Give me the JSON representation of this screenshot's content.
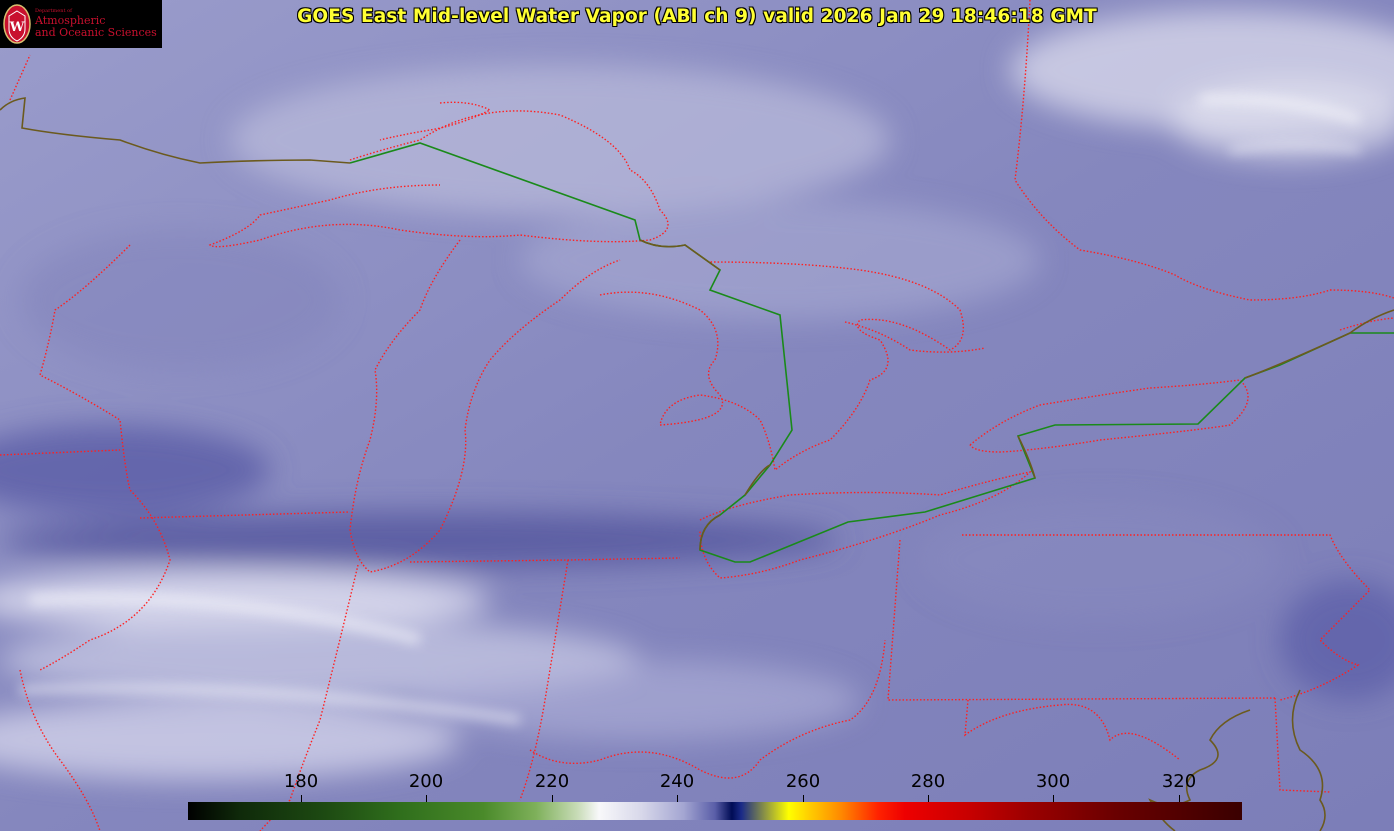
{
  "header": {
    "title": "GOES East Mid-level Water Vapor (ABI ch 9)  valid 2026 Jan 29 18:46:18 GMT"
  },
  "logo": {
    "department": "Department of",
    "name_line1": "Atmospheric",
    "name_line2": "and Oceanic Sciences",
    "seal_letter": "W"
  },
  "map": {
    "satellite": "GOES East",
    "channel": "ABI ch 9",
    "product": "Mid-level Water Vapor",
    "colors": {
      "state_borders": "#ff2020",
      "international_border": "#1a8a1a",
      "coastline": "#6b5a1e"
    }
  },
  "colorbar": {
    "labels": [
      "180",
      "200",
      "220",
      "240",
      "260",
      "280",
      "300",
      "320"
    ]
  }
}
